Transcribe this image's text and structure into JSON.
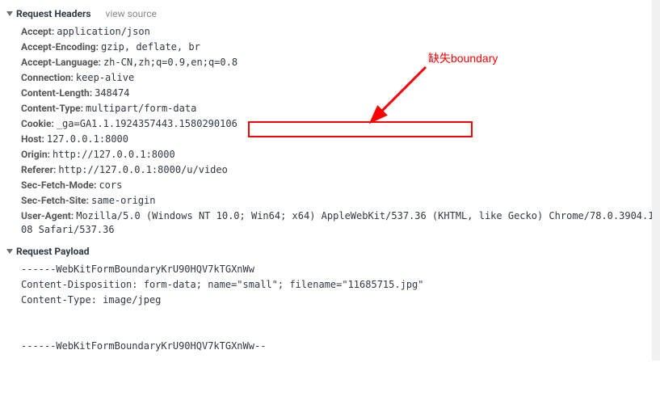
{
  "sections": {
    "requestHeaders": {
      "title": "Request Headers",
      "viewSource": "view source",
      "items": [
        {
          "name": "Accept:",
          "value": "application/json"
        },
        {
          "name": "Accept-Encoding:",
          "value": "gzip, deflate, br"
        },
        {
          "name": "Accept-Language:",
          "value": "zh-CN,zh;q=0.9,en;q=0.8"
        },
        {
          "name": "Connection:",
          "value": "keep-alive"
        },
        {
          "name": "Content-Length:",
          "value": "348474"
        },
        {
          "name": "Content-Type:",
          "value": "multipart/form-data"
        },
        {
          "name": "Cookie:",
          "value": "_ga=GA1.1.1924357443.1580290106"
        },
        {
          "name": "Host:",
          "value": "127.0.0.1:8000"
        },
        {
          "name": "Origin:",
          "value": "http://127.0.0.1:8000"
        },
        {
          "name": "Referer:",
          "value": "http://127.0.0.1:8000/u/video"
        },
        {
          "name": "Sec-Fetch-Mode:",
          "value": "cors"
        },
        {
          "name": "Sec-Fetch-Site:",
          "value": "same-origin"
        },
        {
          "name": "User-Agent:",
          "value": "Mozilla/5.0 (Windows NT 10.0; Win64; x64) AppleWebKit/537.36 (KHTML, like Gecko) Chrome/78.0.3904.108 Safari/537.36"
        }
      ]
    },
    "requestPayload": {
      "title": "Request Payload",
      "lines": [
        "------WebKitFormBoundaryKrU90HQV7kTGXnWw",
        "Content-Disposition: form-data; name=\"small\"; filename=\"11685715.jpg\"",
        "Content-Type: image/jpeg",
        "",
        "",
        "------WebKitFormBoundaryKrU90HQV7kTGXnWw--"
      ]
    }
  },
  "annotation": {
    "text": "缺失boundary"
  }
}
